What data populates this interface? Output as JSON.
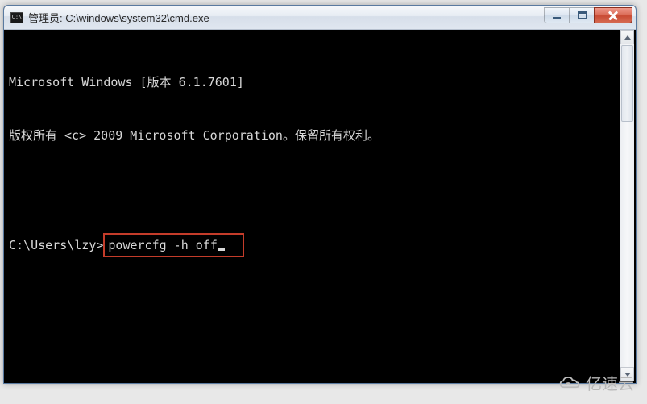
{
  "window": {
    "title": "管理员: C:\\windows\\system32\\cmd.exe"
  },
  "terminal": {
    "line1": "Microsoft Windows [版本 6.1.7601]",
    "line2": "版权所有 <c> 2009 Microsoft Corporation。保留所有权利。",
    "prompt": "C:\\Users\\lzy>",
    "command": "powercfg -h off"
  },
  "watermark": {
    "text": "亿速云"
  }
}
